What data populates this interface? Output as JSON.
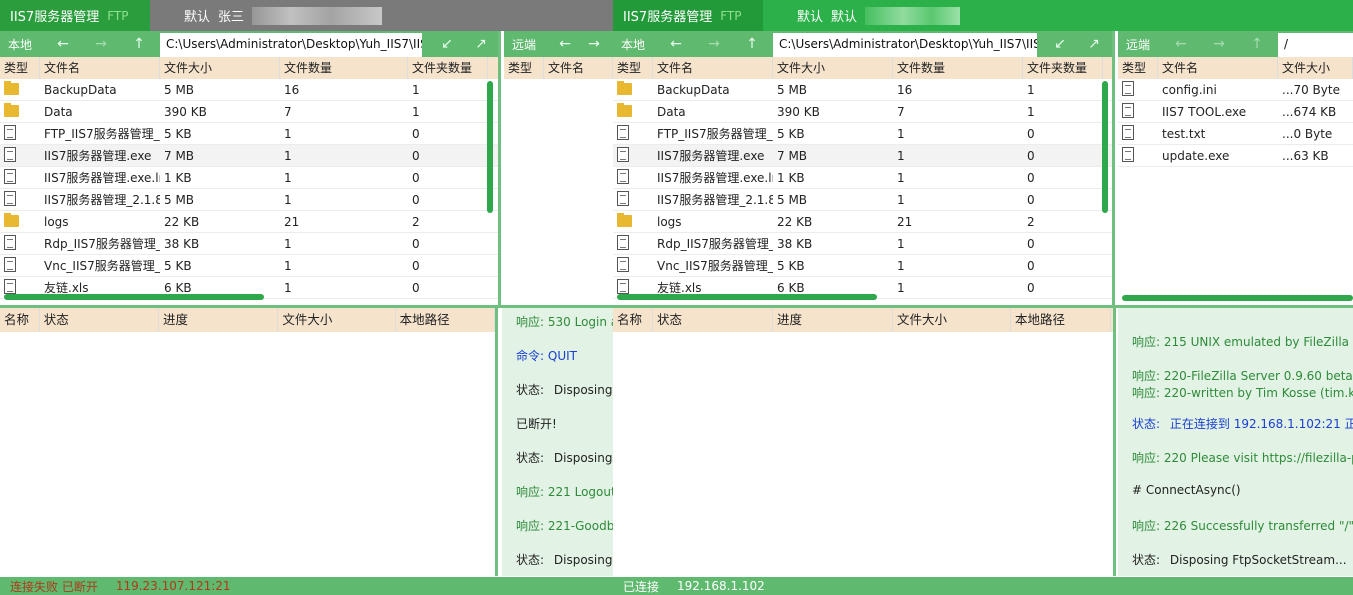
{
  "left": {
    "app_title": "IIS7服务器管理",
    "ftp_tag": "FTP",
    "user_default": "默认",
    "user_name": "张三",
    "local_label": "本地",
    "local_path": "C:\\Users\\Administrator\\Desktop\\Yuh_IIS7\\IIS",
    "remote_label": "远端",
    "local_columns": [
      "类型",
      "文件名",
      "文件大小",
      "文件数量",
      "文件夹数量"
    ],
    "remote_columns": [
      "类型",
      "文件名"
    ],
    "files": [
      {
        "type": "folder",
        "name": "BackupData",
        "size": "5 MB",
        "count": "16",
        "folders": "1"
      },
      {
        "type": "folder",
        "name": "Data",
        "size": "390 KB",
        "count": "7",
        "folders": "1"
      },
      {
        "type": "file",
        "name": "FTP_IIS7服务器管理_",
        "size": "5 KB",
        "count": "1",
        "folders": "0"
      },
      {
        "type": "file",
        "name": "IIS7服务器管理.exe",
        "size": "7 MB",
        "count": "1",
        "folders": "0"
      },
      {
        "type": "file",
        "name": "IIS7服务器管理.exe.lr",
        "size": "1 KB",
        "count": "1",
        "folders": "0"
      },
      {
        "type": "file",
        "name": "IIS7服务器管理_2.1.8",
        "size": "5 MB",
        "count": "1",
        "folders": "0"
      },
      {
        "type": "folder",
        "name": "logs",
        "size": "22 KB",
        "count": "21",
        "folders": "2"
      },
      {
        "type": "file",
        "name": "Rdp_IIS7服务器管理_",
        "size": "38 KB",
        "count": "1",
        "folders": "0"
      },
      {
        "type": "file",
        "name": "Vnc_IIS7服务器管理_",
        "size": "5 KB",
        "count": "1",
        "folders": "0"
      },
      {
        "type": "file",
        "name": "友链.xls",
        "size": "6 KB",
        "count": "1",
        "folders": "0"
      }
    ],
    "queue_columns": [
      "名称",
      "状态",
      "进度",
      "文件大小",
      "本地路径"
    ],
    "log": [
      {
        "kind": "resp",
        "prefix": "响应:",
        "text": "530 Login a"
      },
      {
        "kind": "cmd",
        "prefix": "命令:",
        "text": "QUIT"
      },
      {
        "kind": "stat",
        "prefix": "状态:",
        "text": "Disposing"
      },
      {
        "kind": "plain",
        "prefix": "",
        "text": "已断开!"
      },
      {
        "kind": "stat",
        "prefix": "状态:",
        "text": "Disposing"
      },
      {
        "kind": "resp",
        "prefix": "响应:",
        "text": "221 Logout."
      },
      {
        "kind": "resp",
        "prefix": "响应:",
        "text": "221-Goodby"
      },
      {
        "kind": "stat",
        "prefix": "状态:",
        "text": "Disposing"
      }
    ],
    "status_text": "连接失败 已断开",
    "status_ip": "119.23.107.121:21",
    "status_color": "#b03a1a"
  },
  "right": {
    "app_title": "IIS7服务器管理",
    "ftp_tag": "FTP",
    "user_default": "默认",
    "user_name": "默认",
    "local_label": "本地",
    "local_path": "C:\\Users\\Administrator\\Desktop\\Yuh_IIS7\\IIS",
    "remote_label": "远端",
    "remote_path": "/",
    "local_columns": [
      "类型",
      "文件名",
      "文件大小",
      "文件数量",
      "文件夹数量"
    ],
    "remote_columns": [
      "类型",
      "文件名",
      "文件大小"
    ],
    "files": [
      {
        "type": "folder",
        "name": "BackupData",
        "size": "5 MB",
        "count": "16",
        "folders": "1"
      },
      {
        "type": "folder",
        "name": "Data",
        "size": "390 KB",
        "count": "7",
        "folders": "1"
      },
      {
        "type": "file",
        "name": "FTP_IIS7服务器管理_",
        "size": "5 KB",
        "count": "1",
        "folders": "0"
      },
      {
        "type": "file",
        "name": "IIS7服务器管理.exe",
        "size": "7 MB",
        "count": "1",
        "folders": "0"
      },
      {
        "type": "file",
        "name": "IIS7服务器管理.exe.lr",
        "size": "1 KB",
        "count": "1",
        "folders": "0"
      },
      {
        "type": "file",
        "name": "IIS7服务器管理_2.1.8",
        "size": "5 MB",
        "count": "1",
        "folders": "0"
      },
      {
        "type": "folder",
        "name": "logs",
        "size": "22 KB",
        "count": "21",
        "folders": "2"
      },
      {
        "type": "file",
        "name": "Rdp_IIS7服务器管理_",
        "size": "38 KB",
        "count": "1",
        "folders": "0"
      },
      {
        "type": "file",
        "name": "Vnc_IIS7服务器管理_",
        "size": "5 KB",
        "count": "1",
        "folders": "0"
      },
      {
        "type": "file",
        "name": "友链.xls",
        "size": "6 KB",
        "count": "1",
        "folders": "0"
      }
    ],
    "remote_files": [
      {
        "name": "config.ini",
        "size": "...70 Byte"
      },
      {
        "name": "IIS7 TOOL.exe",
        "size": "...674 KB"
      },
      {
        "name": "test.txt",
        "size": "...0 Byte"
      },
      {
        "name": "update.exe",
        "size": "...63 KB"
      }
    ],
    "queue_columns": [
      "名称",
      "状态",
      "进度",
      "文件大小",
      "本地路径"
    ],
    "log": [
      {
        "kind": "resp",
        "prefix": "响应:",
        "text": "215 UNIX emulated by FileZilla"
      },
      {
        "kind": "resp",
        "prefix": "响应:",
        "text": "220-FileZilla Server 0.9.60 beta"
      },
      {
        "kind": "resp",
        "prefix": "响应:",
        "text": "220-written by Tim Kosse (tim.kos"
      },
      {
        "kind": "statb",
        "prefix": "状态:",
        "text": "正在连接到  192.168.1.102:21  正在"
      },
      {
        "kind": "resp",
        "prefix": "响应:",
        "text": "220 Please visit https://filezilla-pro"
      },
      {
        "kind": "plain",
        "prefix": "",
        "text": "# ConnectAsync()"
      },
      {
        "kind": "resp",
        "prefix": "响应:",
        "text": "226 Successfully transferred \"/\""
      },
      {
        "kind": "stat",
        "prefix": "状态:",
        "text": "Disposing FtpSocketStream..."
      }
    ],
    "status_text": "已连接",
    "status_ip": "192.168.1.102",
    "status_color": "#ffffff"
  },
  "colors": {
    "accent": "#2bb04a",
    "header_bg": "#f5e3cc",
    "log_bg": "#e2f2e4",
    "nav": "#5fb96f"
  }
}
